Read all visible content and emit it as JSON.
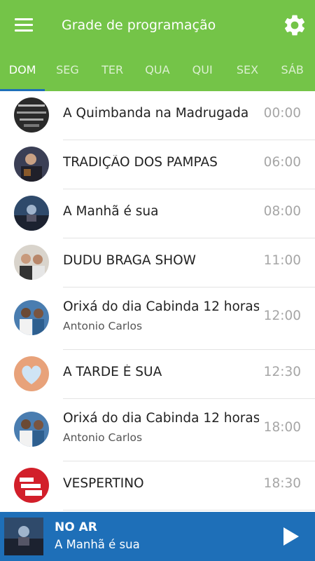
{
  "header": {
    "title": "Grade de programação",
    "menu_icon": "hamburger-menu-icon",
    "settings_icon": "gear-icon",
    "color": "#74c448"
  },
  "tabs": [
    {
      "label": "DOM",
      "active": true
    },
    {
      "label": "SEG",
      "active": false
    },
    {
      "label": "TER",
      "active": false
    },
    {
      "label": "QUA",
      "active": false
    },
    {
      "label": "QUI",
      "active": false
    },
    {
      "label": "SEX",
      "active": false
    },
    {
      "label": "SÁB",
      "active": false
    }
  ],
  "schedule": [
    {
      "title": "A Quimbanda na Madrugada",
      "host": "",
      "time": "00:00"
    },
    {
      "title": "TRADIÇÃO DOS PAMPAS",
      "host": "",
      "time": "06:00"
    },
    {
      "title": "A Manhã é sua",
      "host": "",
      "time": "08:00"
    },
    {
      "title": "DUDU BRAGA SHOW",
      "host": "",
      "time": "11:00"
    },
    {
      "title": "Orixá do dia Cabinda 12 horas",
      "host": "Antonio Carlos",
      "time": "12:00"
    },
    {
      "title": "A TARDE É SUA",
      "host": "",
      "time": "12:30"
    },
    {
      "title": "Orixá do dia Cabinda 12 horas",
      "host": "Antonio Carlos",
      "time": "18:00"
    },
    {
      "title": "VESPERTINO",
      "host": "",
      "time": "18:30"
    }
  ],
  "player": {
    "status": "NO AR",
    "now_playing": "A Manhã é sua",
    "play_icon": "play-icon",
    "color": "#1e6fb8"
  }
}
